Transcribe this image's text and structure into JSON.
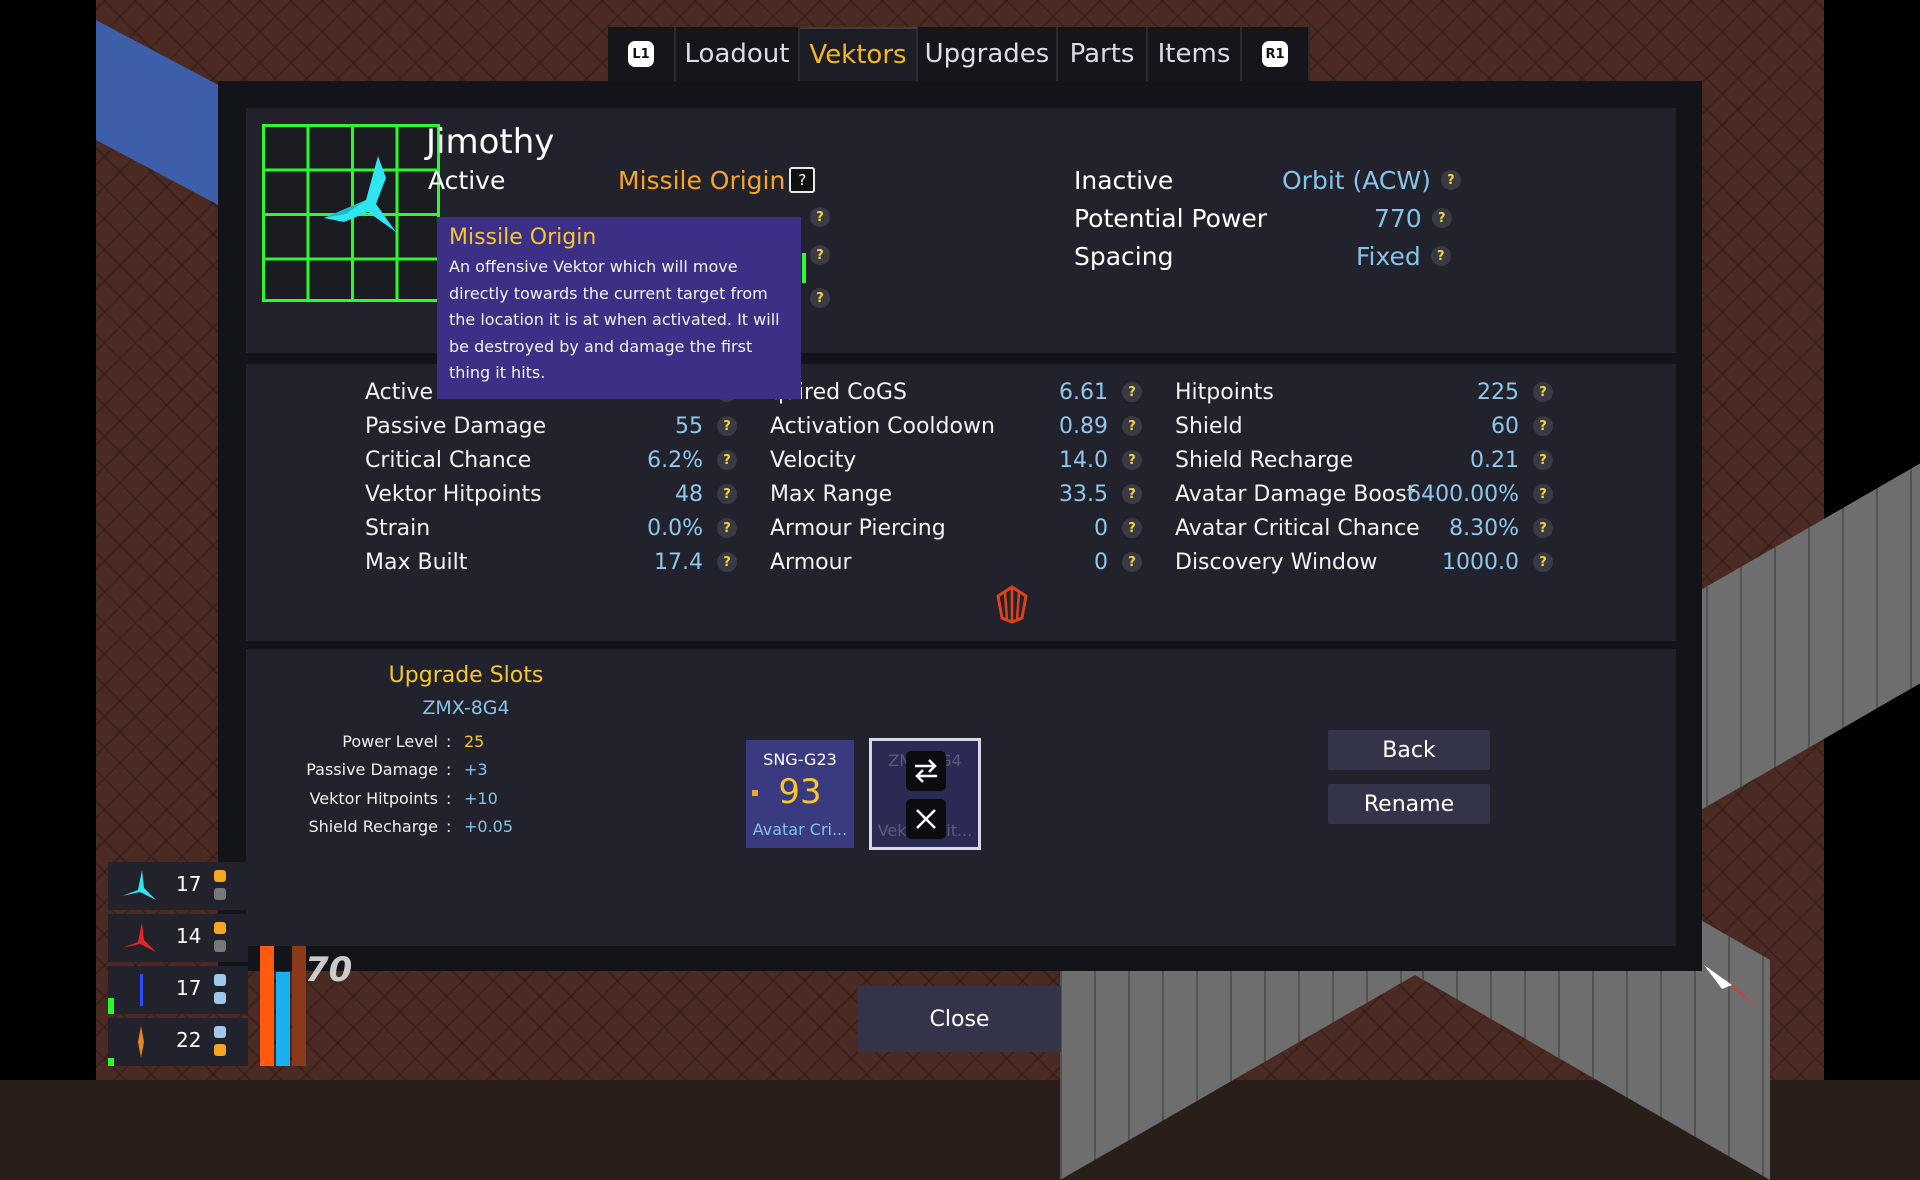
{
  "tabs": {
    "left_shoulder": "L1",
    "right_shoulder": "R1",
    "items": [
      {
        "label": "Loadout",
        "active": false
      },
      {
        "label": "Vektors",
        "active": true
      },
      {
        "label": "Upgrades",
        "active": false
      },
      {
        "label": "Parts",
        "active": false
      },
      {
        "label": "Items",
        "active": false
      }
    ]
  },
  "vektor": {
    "name": "Jimothy",
    "active_label": "Active",
    "active_value": "Missile Origin",
    "inactive_label": "Inactive",
    "inactive_value": "Orbit (ACW)",
    "potential_power_label": "Potential Power",
    "potential_power_value": "770",
    "spacing_label": "Spacing",
    "spacing_value": "Fixed",
    "help_glyph": "?"
  },
  "tooltip": {
    "title": "Missile Origin",
    "body": "An offensive Vektor which will move directly towards the current target from the location it is at when activated. It will be destroyed by and damage the first thing it hits."
  },
  "stats": {
    "col1": [
      {
        "name": "Active",
        "value": ""
      },
      {
        "name": "Passive Damage",
        "value": "55"
      },
      {
        "name": "Critical Chance",
        "value": "6.2%"
      },
      {
        "name": "Vektor Hitpoints",
        "value": "48"
      },
      {
        "name": "Strain",
        "value": "0.0%"
      },
      {
        "name": "Max Built",
        "value": "17.4"
      }
    ],
    "col2": [
      {
        "name": "quired CoGS",
        "value": "6.61"
      },
      {
        "name": "Activation Cooldown",
        "value": "0.89"
      },
      {
        "name": "Velocity",
        "value": "14.0"
      },
      {
        "name": "Max Range",
        "value": "33.5"
      },
      {
        "name": "Armour Piercing",
        "value": "0"
      },
      {
        "name": "Armour",
        "value": "0"
      }
    ],
    "col3": [
      {
        "name": "Hitpoints",
        "value": "225"
      },
      {
        "name": "Shield",
        "value": "60"
      },
      {
        "name": "Shield Recharge",
        "value": "0.21"
      },
      {
        "name": "Avatar Damage Boost",
        "value": "6400.00%"
      },
      {
        "name": "Avatar Critical Chance",
        "value": "8.30%"
      },
      {
        "name": "Discovery Window",
        "value": "1000.0"
      }
    ]
  },
  "upgrades": {
    "title": "Upgrade Slots",
    "code": "ZMX-8G4",
    "rows": [
      {
        "name": "Power Level",
        "value": "25",
        "color": "#f5c82a"
      },
      {
        "name": "Passive Damage",
        "value": "+3",
        "color": "#86c3e8"
      },
      {
        "name": "Vektor Hitpoints",
        "value": "+10",
        "color": "#86c3e8"
      },
      {
        "name": "Shield Recharge",
        "value": "+0.05",
        "color": "#86c3e8"
      }
    ],
    "colon": ":",
    "slot1": {
      "name": "SNG-G23",
      "number": "93",
      "sub": "Avatar Cri..."
    },
    "slot2": {
      "name": "ZMX-8G4",
      "number": "",
      "sub": "Vektor Hit..."
    }
  },
  "buttons": {
    "back": "Back",
    "rename": "Rename",
    "close": "Close"
  },
  "hud": {
    "counts": [
      "17",
      "14",
      "17",
      "22"
    ],
    "score": "70"
  },
  "colors": {
    "accent_orange": "#f5a623",
    "value_blue": "#86c3e8",
    "highlight_yellow": "#f5c82a",
    "grid_green": "#2dfa2d",
    "tooltip_purple": "#3c2f86"
  }
}
